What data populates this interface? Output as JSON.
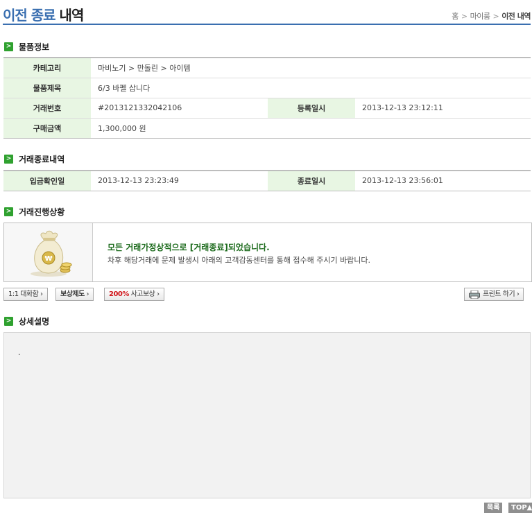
{
  "header": {
    "title_blue": "이전 종료",
    "title_black": "내역",
    "breadcrumb": [
      "홈",
      "마이룸",
      "이전 내역"
    ]
  },
  "item_info": {
    "section_title": "물품정보",
    "category_label": "카테고리",
    "category_value": "마비노기 > 만돌린 > 아이템",
    "title_label": "물품제목",
    "title_value": "6/3 바펠 삽니다",
    "trade_no_label": "거래번호",
    "trade_no_value": "#2013121332042106",
    "reg_date_label": "등록일시",
    "reg_date_value": "2013-12-13 23:12:11",
    "price_label": "구매금액",
    "price_value": "1,300,000 원"
  },
  "completion": {
    "section_title": "거래종료내역",
    "deposit_label": "입금확인일",
    "deposit_value": "2013-12-13 23:23:49",
    "end_label": "종료일시",
    "end_value": "2013-12-13 23:56:01"
  },
  "progress": {
    "section_title": "거래진행상황",
    "message_main": "모든 거래가정상적으로 [거래종료]되었습니다.",
    "message_sub": "차후 해당거래에 문제 발생시 아래의 고객감동센터를 통해 접수해 주시기 바랍니다."
  },
  "buttons": {
    "chat": "1:1 대화함 ›",
    "comp_bold": "보상제도",
    "comp_arrow": " ›",
    "accident_red": "200%",
    "accident_rest": " 사고보상 ›",
    "print": "프린트 하기 ›"
  },
  "detail": {
    "section_title": "상세설명",
    "content": "."
  },
  "footer": {
    "list_btn": "목록",
    "top_btn": "TOP▲"
  },
  "icons": {
    "section_icon": "arrow-right-icon",
    "money_bag": "money-bag-icon",
    "printer": "printer-icon"
  },
  "colors": {
    "accent_blue": "#3a6fb0",
    "label_bg": "#e8f6e3",
    "section_green": "#2fa12f",
    "status_green": "#1d6b1d",
    "accident_red": "#d1161b"
  }
}
